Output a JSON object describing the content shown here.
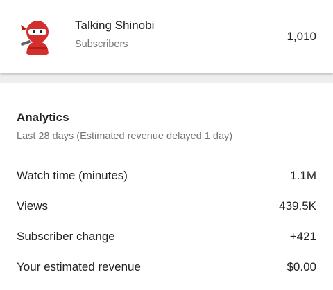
{
  "channel": {
    "name": "Talking Shinobi",
    "subscribers_label": "Subscribers",
    "subscriber_count": "1,010",
    "avatar_icon": "red-ninja-icon"
  },
  "analytics": {
    "title": "Analytics",
    "subtitle": "Last 28 days (Estimated revenue delayed 1 day)",
    "metrics": [
      {
        "label": "Watch time (minutes)",
        "value": "1.1M"
      },
      {
        "label": "Views",
        "value": "439.5K"
      },
      {
        "label": "Subscriber change",
        "value": "+421"
      },
      {
        "label": "Your estimated revenue",
        "value": "$0.00"
      }
    ]
  },
  "colors": {
    "ninja_red": "#d32f2f",
    "secondary_text": "#757575",
    "primary_text": "#212121",
    "divider": "#eeeeee"
  }
}
